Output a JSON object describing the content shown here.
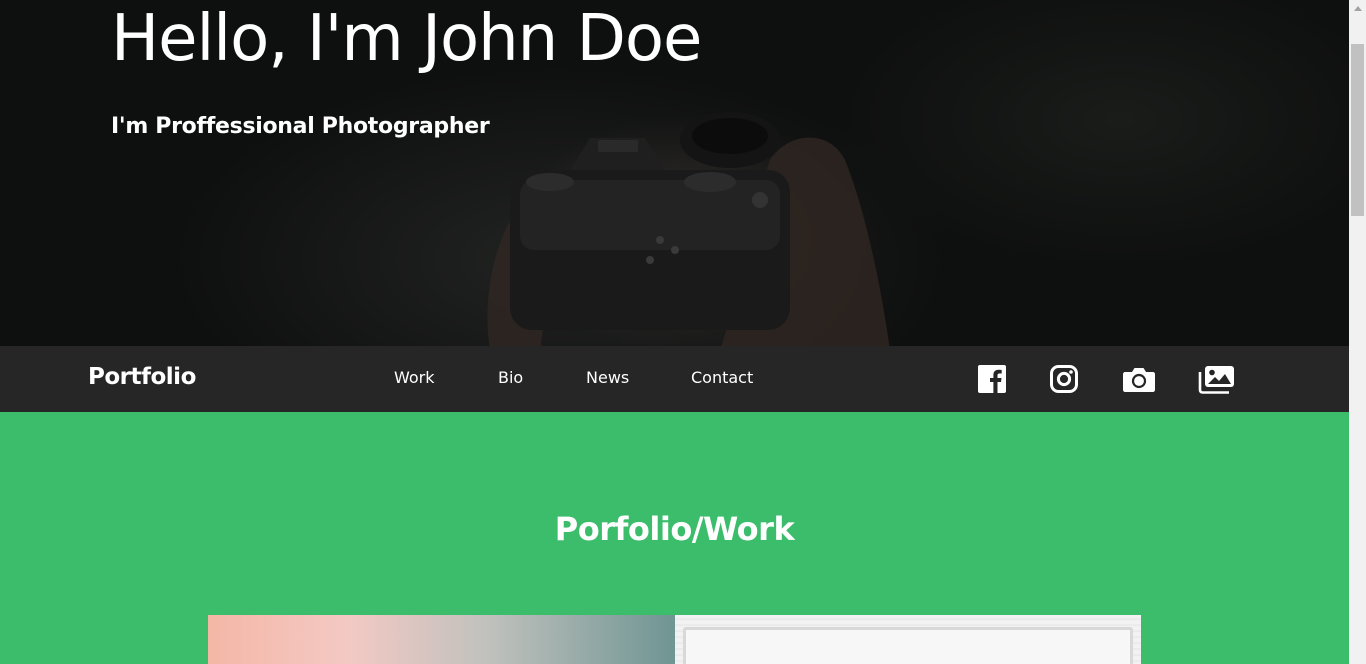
{
  "hero": {
    "title": "Hello, I'm John Doe",
    "subtitle": "I'm Proffessional Photographer",
    "background_image": "camera-in-hands-photo"
  },
  "navbar": {
    "brand": "Portfolio",
    "links": [
      "Work",
      "Bio",
      "News",
      "Contact"
    ],
    "social_icons": [
      "facebook-icon",
      "instagram-icon",
      "camera-icon",
      "images-icon"
    ]
  },
  "work_section": {
    "title": "Porfolio/Work",
    "background_color": "#3cbd6b",
    "thumbnails": [
      "pastel-gradient-photo",
      "white-wood-frame-photo"
    ]
  },
  "colors": {
    "hero_background": "#0e0f0f",
    "navbar_background": "#262626",
    "text": "#ffffff",
    "accent": "#3cbd6b"
  }
}
